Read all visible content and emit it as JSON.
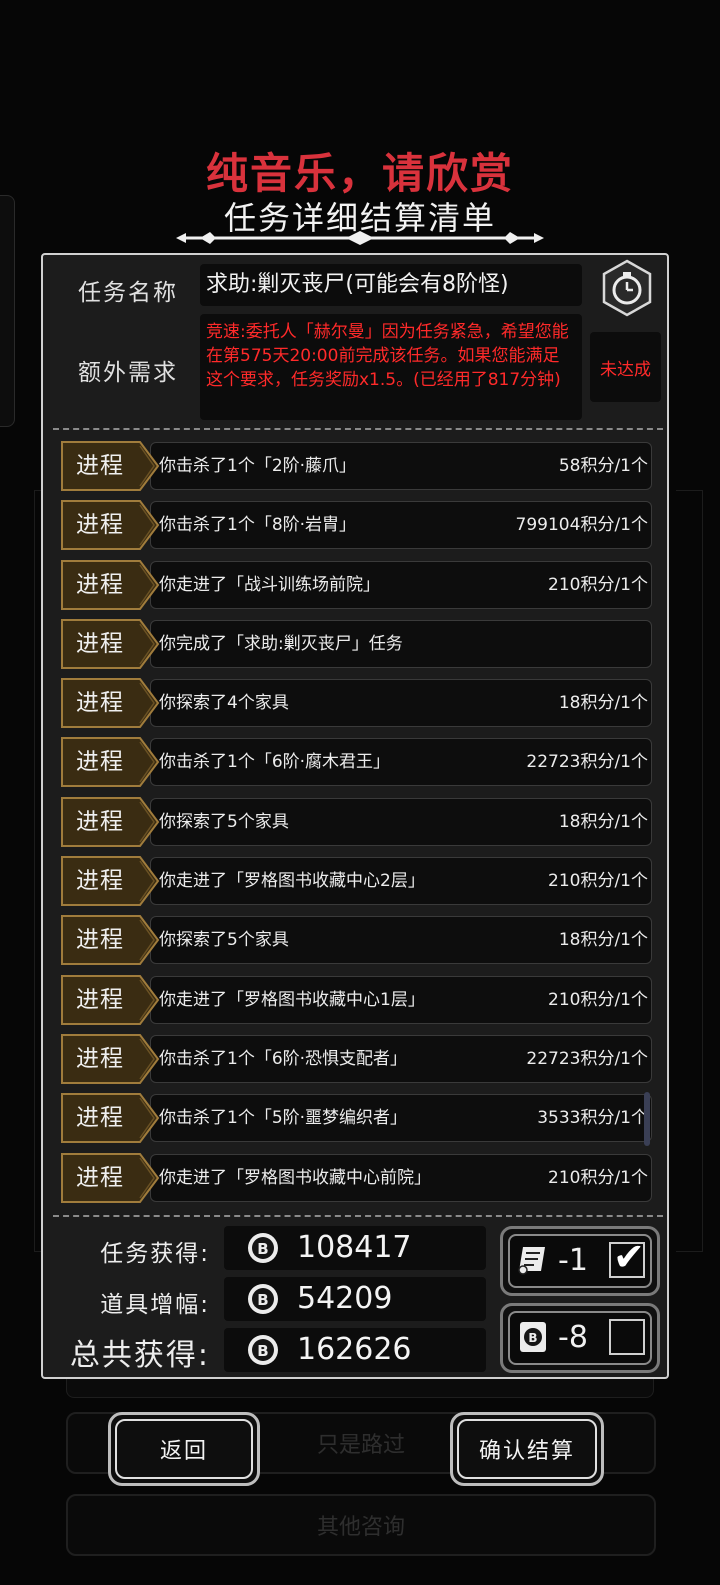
{
  "header": {
    "title": "纯音乐，请欣赏",
    "subtitle": "任务详细结算清单"
  },
  "quest": {
    "name_label": "任务名称",
    "name": "求助:剿灭丧尸(可能会有8阶怪)",
    "extra_label": "额外需求",
    "extra_text": "竞速:委托人「赫尔曼」因为任务紧急，希望您能在第575天20:00前完成该任务。如果您能满足这个要求，任务奖励x1.5。(已经用了817分钟)",
    "extra_status": "未达成",
    "timer_icon": "stopwatch-icon"
  },
  "progress": [
    {
      "tag": "进程",
      "text": "你击杀了1个「2阶·藤爪」",
      "score": "58积分/1个"
    },
    {
      "tag": "进程",
      "text": "你击杀了1个「8阶·岩胄」",
      "score": "799104积分/1个"
    },
    {
      "tag": "进程",
      "text": "你走进了「战斗训练场前院」",
      "score": "210积分/1个"
    },
    {
      "tag": "进程",
      "text": "你完成了「求助:剿灭丧尸」任务",
      "score": ""
    },
    {
      "tag": "进程",
      "text": "你探索了4个家具",
      "score": "18积分/1个"
    },
    {
      "tag": "进程",
      "text": "你击杀了1个「6阶·腐木君王」",
      "score": "22723积分/1个"
    },
    {
      "tag": "进程",
      "text": "你探索了5个家具",
      "score": "18积分/1个"
    },
    {
      "tag": "进程",
      "text": "你走进了「罗格图书收藏中心2层」",
      "score": "210积分/1个"
    },
    {
      "tag": "进程",
      "text": "你探索了5个家具",
      "score": "18积分/1个"
    },
    {
      "tag": "进程",
      "text": "你走进了「罗格图书收藏中心1层」",
      "score": "210积分/1个"
    },
    {
      "tag": "进程",
      "text": "你击杀了1个「6阶·恐惧支配者」",
      "score": "22723积分/1个"
    },
    {
      "tag": "进程",
      "text": "你击杀了1个「5阶·噩梦编织者」",
      "score": "3533积分/1个"
    },
    {
      "tag": "进程",
      "text": "你走进了「罗格图书收藏中心前院」",
      "score": "210积分/1个"
    }
  ],
  "summary": {
    "task_label": "任务获得:",
    "task_value": "108417",
    "item_label": "道具增幅:",
    "item_value": "54209",
    "total_label": "总共获得:",
    "total_value": "162626",
    "coin_icon": "coin-b-icon"
  },
  "modifiers": {
    "scroll_value": "-1",
    "scroll_checked": true,
    "card_value": "-8",
    "card_checked": false
  },
  "background": {
    "option1": "只是路过",
    "option2": "其他咨询"
  },
  "buttons": {
    "back": "返回",
    "confirm": "确认结算"
  },
  "colors": {
    "title_red": "#d9323c",
    "warning_red": "#ff2a2a",
    "tag_gold": "#8a6a32"
  }
}
